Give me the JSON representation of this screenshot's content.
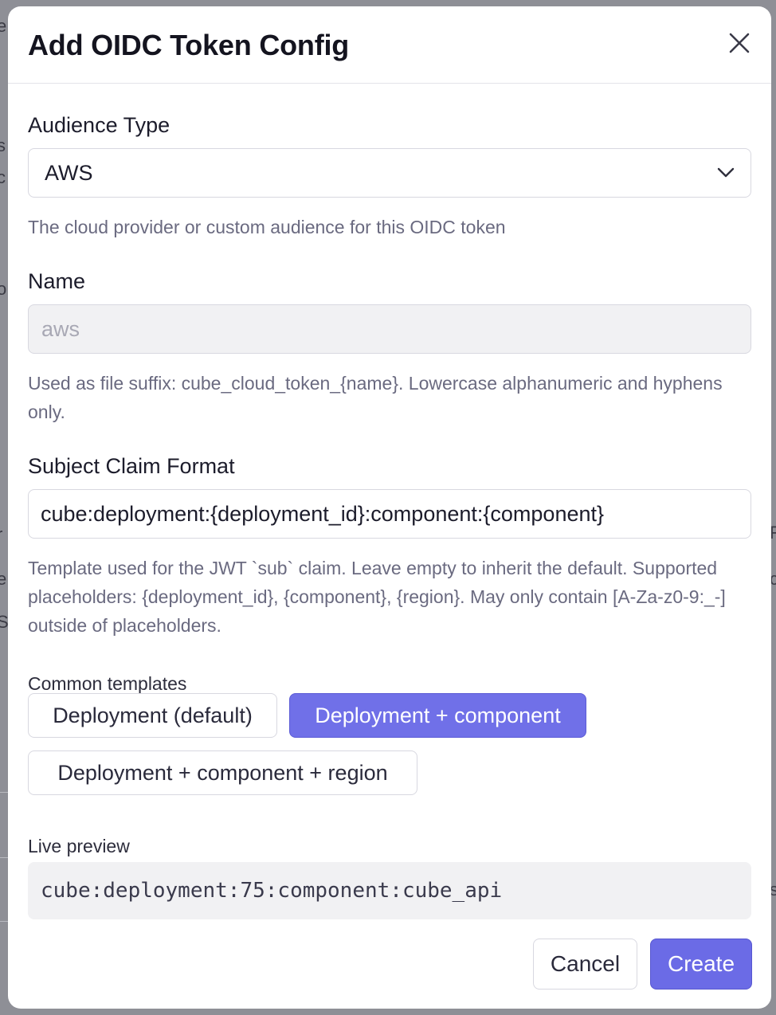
{
  "dialog": {
    "title": "Add OIDC Token Config",
    "close_icon": "close-icon"
  },
  "audience": {
    "label": "Audience Type",
    "selected": "AWS",
    "hint": "The cloud provider or custom audience for this OIDC token",
    "chevron_icon": "chevron-down-icon"
  },
  "name": {
    "label": "Name",
    "placeholder": "aws",
    "hint": "Used as file suffix: cube_cloud_token_{name}. Lowercase alphanumeric and hyphens only."
  },
  "subject": {
    "label": "Subject Claim Format",
    "value": "cube:deployment:{deployment_id}:component:{component}",
    "hint": "Template used for the JWT `sub` claim. Leave empty to inherit the default. Supported placeholders: {deployment_id}, {component}, {region}. May only contain [A-Za-z0-9:_-] outside of placeholders."
  },
  "templates": {
    "label": "Common templates",
    "items": [
      {
        "label": "Deployment (default)",
        "active": false
      },
      {
        "label": "Deployment + component",
        "active": true
      },
      {
        "label": "Deployment + component + region",
        "active": false
      }
    ]
  },
  "preview": {
    "label": "Live preview",
    "value": "cube:deployment:75:component:cube_api"
  },
  "footer": {
    "cancel_label": "Cancel",
    "create_label": "Create"
  },
  "colors": {
    "accent": "#6b6be6",
    "overlay": "#8e8f96"
  }
}
